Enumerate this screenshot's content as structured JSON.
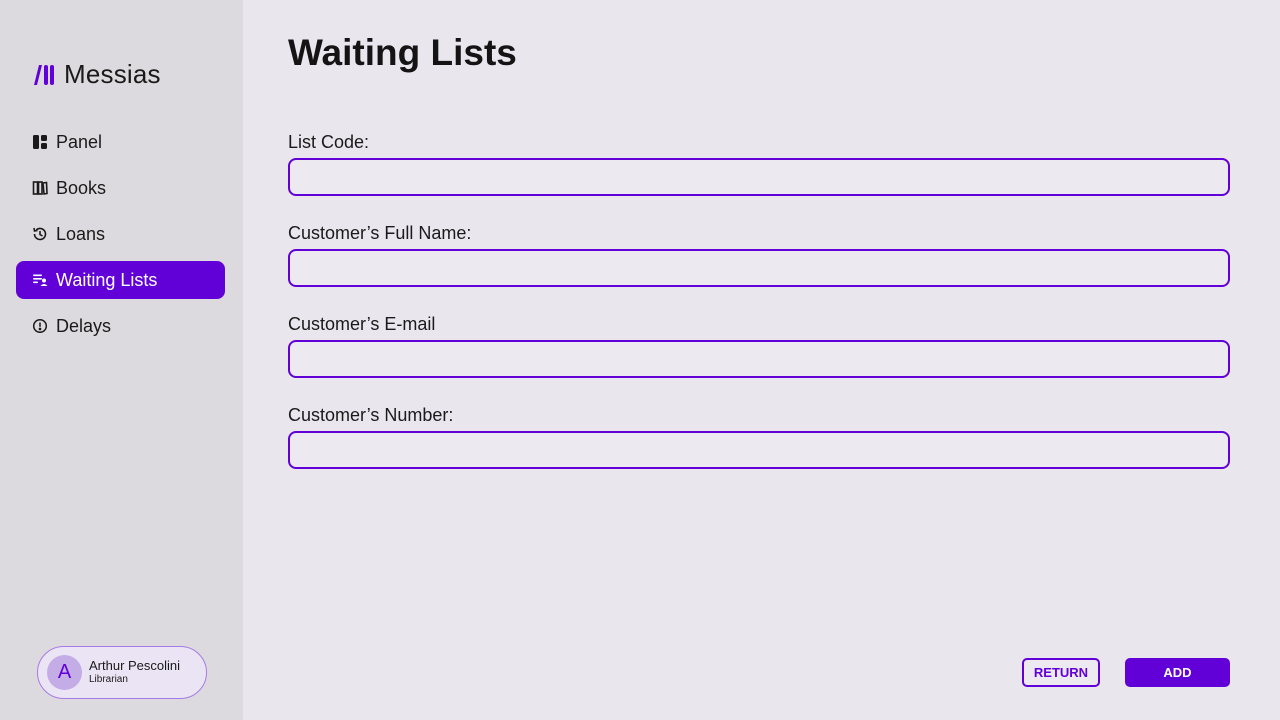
{
  "brand": {
    "name": "Messias"
  },
  "sidebar": {
    "items": [
      {
        "label": "Panel",
        "icon": "panel-icon",
        "active": false
      },
      {
        "label": "Books",
        "icon": "books-icon",
        "active": false
      },
      {
        "label": "Loans",
        "icon": "history-icon",
        "active": false
      },
      {
        "label": "Waiting Lists",
        "icon": "waiting-list-icon",
        "active": true
      },
      {
        "label": "Delays",
        "icon": "alert-circle-icon",
        "active": false
      }
    ]
  },
  "user": {
    "initial": "A",
    "name": "Arthur Pescolini",
    "role": "Librarian"
  },
  "page": {
    "title": "Waiting Lists"
  },
  "form": {
    "list_code": {
      "label": "List Code:",
      "value": "",
      "placeholder": ""
    },
    "full_name": {
      "label": "Customer’s Full Name:",
      "value": "",
      "placeholder": ""
    },
    "email": {
      "label": "Customer’s E-mail",
      "value": "",
      "placeholder": ""
    },
    "number": {
      "label": "Customer’s Number:",
      "value": "",
      "placeholder": ""
    }
  },
  "actions": {
    "return_label": "RETURN",
    "add_label": "ADD"
  },
  "colors": {
    "accent": "#6200d8",
    "sidebar_bg": "#dcdade",
    "page_bg": "#e9e6ee"
  }
}
